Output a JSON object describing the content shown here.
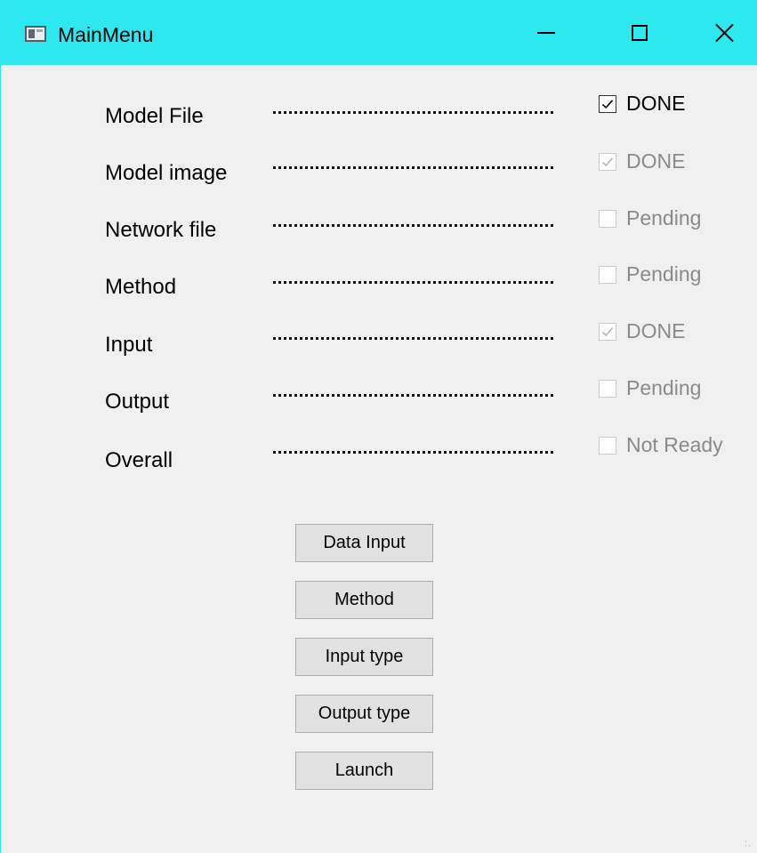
{
  "window": {
    "title": "MainMenu",
    "titlebar_color": "#2de8ee",
    "icon": "app-window-icon",
    "controls": {
      "minimize": "minimize-icon",
      "maximize": "maximize-icon",
      "close": "close-icon"
    }
  },
  "rows": [
    {
      "label": "Model File",
      "status": "DONE",
      "checked": true,
      "enabled": true
    },
    {
      "label": "Model image",
      "status": "DONE",
      "checked": true,
      "enabled": false
    },
    {
      "label": "Network file",
      "status": "Pending",
      "checked": false,
      "enabled": false
    },
    {
      "label": "Method",
      "status": "Pending",
      "checked": false,
      "enabled": false
    },
    {
      "label": "Input",
      "status": "DONE",
      "checked": true,
      "enabled": false
    },
    {
      "label": "Output",
      "status": "Pending",
      "checked": false,
      "enabled": false
    },
    {
      "label": "Overall",
      "status": "Not Ready",
      "checked": false,
      "enabled": false
    }
  ],
  "buttons": [
    {
      "label": "Data Input"
    },
    {
      "label": "Method"
    },
    {
      "label": "Input type"
    },
    {
      "label": "Output type"
    },
    {
      "label": "Launch"
    }
  ]
}
